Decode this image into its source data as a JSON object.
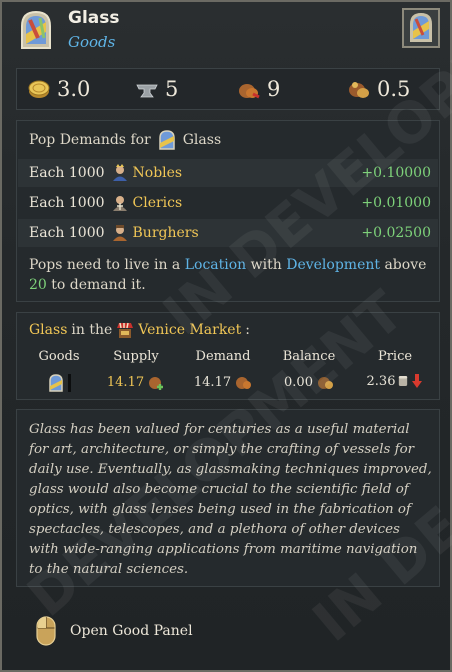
{
  "header": {
    "title": "Glass",
    "subtitle": "Goods",
    "icon": "stained-glass-icon"
  },
  "stats": [
    {
      "icon": "gold-coins-icon",
      "value": "3.0"
    },
    {
      "icon": "anvil-icon",
      "value": "5"
    },
    {
      "icon": "goods-sack-icon",
      "value": "9"
    },
    {
      "icon": "trade-goods-icon",
      "value": "0.5"
    }
  ],
  "demands": {
    "heading_prefix": "Pop Demands for",
    "heading_good": "Glass",
    "rows": [
      {
        "each": "Each 1000",
        "pop": "Nobles",
        "value": "+0.10000"
      },
      {
        "each": "Each 1000",
        "pop": "Clerics",
        "value": "+0.01000"
      },
      {
        "each": "Each 1000",
        "pop": "Burghers",
        "value": "+0.02500"
      }
    ],
    "note": {
      "p1": "Pops need to live in a",
      "location": "Location",
      "p2": "with",
      "development": "Development",
      "p3": "above",
      "threshold": "20",
      "p4": "to demand it."
    }
  },
  "market": {
    "good": "Glass",
    "in_the": "in the",
    "market_name": "Venice Market",
    "colon": ":",
    "headers": [
      "Goods",
      "Supply",
      "Demand",
      "Balance",
      "Price"
    ],
    "supply": "14.17",
    "demand": "14.17",
    "balance": "0.00",
    "price": "2.36"
  },
  "description": "Glass has been valued for centuries as a useful material for art, architecture, or simply the crafting of vessels for daily use. Eventually, as glassmaking techniques improved, glass would also become crucial to the scientific field of optics, with glass lenses being used in the fabrication of spectacles, telescopes, and a plethora of other devices with wide-ranging applications from maritime navigation to the natural sciences.",
  "watermark": [
    "IN DEVELOPM",
    "DEVELOPMENT",
    "IN DE"
  ],
  "footer": {
    "label": "Open Good Panel",
    "icon": "mouse-icon"
  },
  "colors": {
    "accent_blue": "#5fb4e6",
    "positive_green": "#7ed27a",
    "highlight_gold": "#f0c656",
    "price_down_red": "#d83a2e"
  }
}
